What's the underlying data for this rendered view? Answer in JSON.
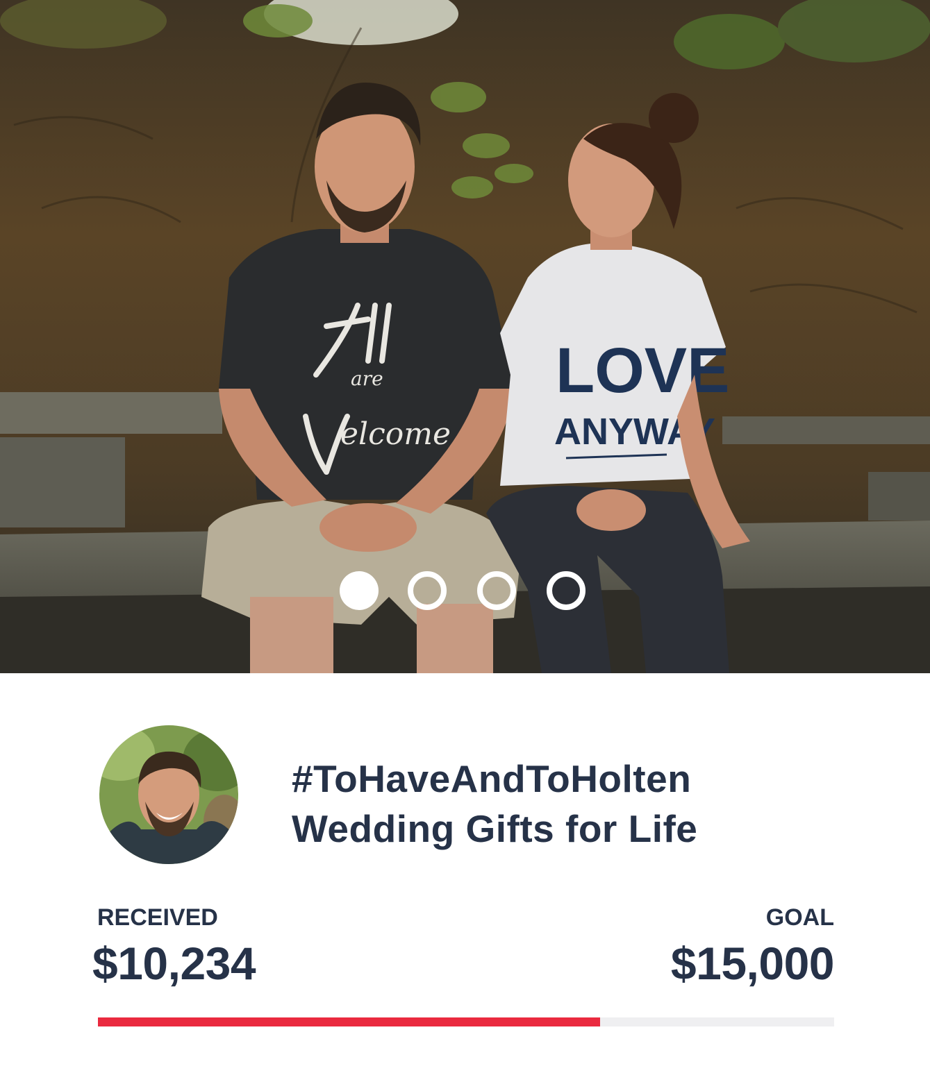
{
  "hero": {
    "carousel": {
      "slide_count": 4,
      "active_index": 0
    }
  },
  "fundraiser": {
    "title_line_1": "#ToHaveAndToHolten",
    "title_line_2": "Wedding Gifts for Life",
    "received_label": "RECEIVED",
    "received_value": "$10,234",
    "goal_label": "GOAL",
    "goal_value": "$15,000",
    "progress_fraction": 0.682
  },
  "colors": {
    "text": "#263248",
    "progress_fill": "#ea2a3f",
    "progress_track": "#efeff1"
  }
}
